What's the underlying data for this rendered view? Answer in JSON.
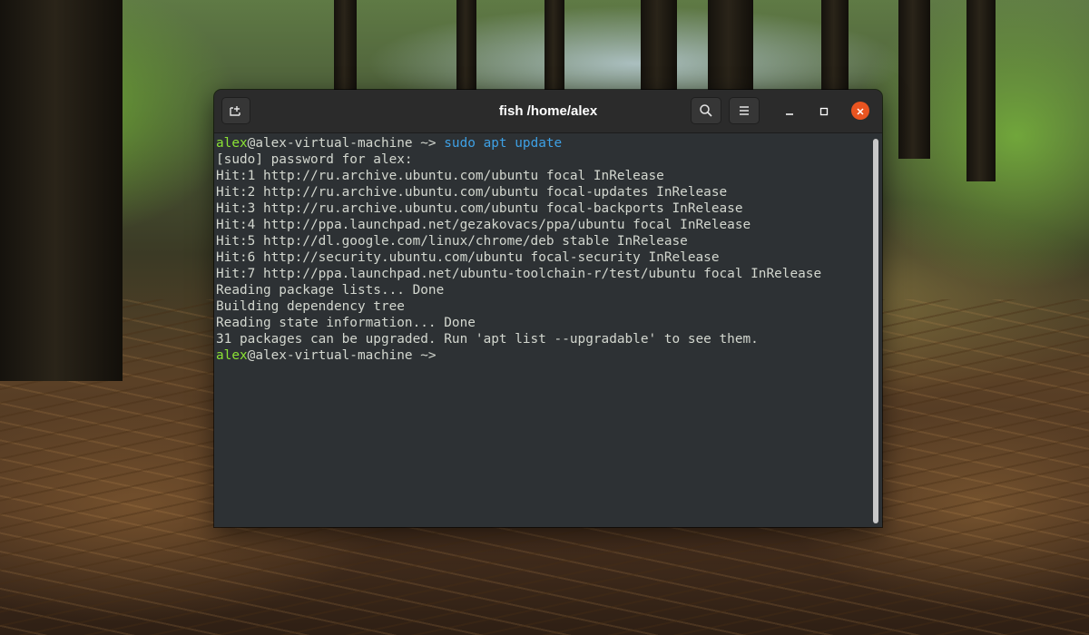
{
  "window": {
    "title": "fish /home/alex",
    "icons": {
      "new_tab": "new-tab-icon",
      "search": "search-icon",
      "menu": "hamburger-menu-icon",
      "minimize": "minimize-icon",
      "maximize": "maximize-icon",
      "close": "close-icon"
    }
  },
  "colors": {
    "terminal_bg": "#2d3134",
    "text": "#d3d7cf",
    "user": "#8ae234",
    "command": "#3ea0e4",
    "close_button": "#e95420"
  },
  "terminal": {
    "prompt1": {
      "user": "alex",
      "host": "@alex-virtual-machine ~> ",
      "command": "sudo apt update"
    },
    "output": [
      "[sudo] password for alex:",
      "Hit:1 http://ru.archive.ubuntu.com/ubuntu focal InRelease",
      "Hit:2 http://ru.archive.ubuntu.com/ubuntu focal-updates InRelease",
      "Hit:3 http://ru.archive.ubuntu.com/ubuntu focal-backports InRelease",
      "Hit:4 http://ppa.launchpad.net/gezakovacs/ppa/ubuntu focal InRelease",
      "Hit:5 http://dl.google.com/linux/chrome/deb stable InRelease",
      "Hit:6 http://security.ubuntu.com/ubuntu focal-security InRelease",
      "Hit:7 http://ppa.launchpad.net/ubuntu-toolchain-r/test/ubuntu focal InRelease",
      "Reading package lists... Done",
      "Building dependency tree",
      "Reading state information... Done",
      "31 packages can be upgraded. Run 'apt list --upgradable' to see them."
    ],
    "prompt2": {
      "user": "alex",
      "host": "@alex-virtual-machine ~>"
    }
  }
}
